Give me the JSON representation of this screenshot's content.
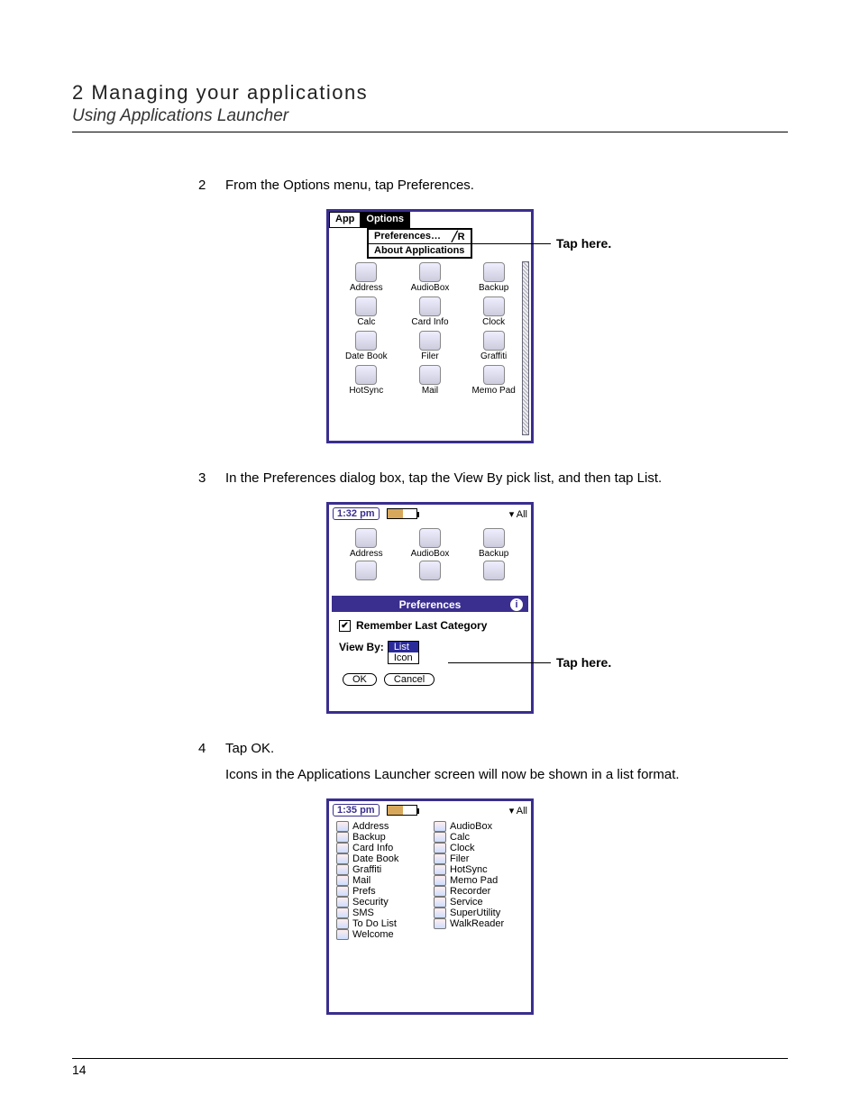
{
  "header": {
    "chapter": "2 Managing your applications",
    "section": "Using Applications Launcher"
  },
  "steps": {
    "s2": {
      "num": "2",
      "text": "From the Options menu, tap Preferences."
    },
    "s3": {
      "num": "3",
      "text": "In the Preferences dialog box, tap the View By pick list, and then tap List."
    },
    "s4": {
      "num": "4",
      "text": "Tap OK.",
      "sub": "Icons in the Applications Launcher screen will now be shown in a list format."
    }
  },
  "callouts": {
    "c1": "Tap here.",
    "c2": "Tap here."
  },
  "palm1": {
    "menu": {
      "app": "App",
      "options": "Options"
    },
    "dropdown": {
      "prefs": "Preferences…",
      "shortcut": "╱R",
      "about": "About Applications"
    },
    "apps": [
      "Address",
      "AudioBox",
      "Backup",
      "Calc",
      "Card Info",
      "Clock",
      "Date Book",
      "Filer",
      "Graffiti",
      "HotSync",
      "Mail",
      "Memo Pad"
    ]
  },
  "palm2": {
    "time": "1:32 pm",
    "picklist_all": "▾ All",
    "apps_top": [
      "Address",
      "AudioBox",
      "Backup"
    ],
    "dialog": {
      "title": "Preferences",
      "info": "i",
      "remember": "Remember Last Category",
      "viewby_label": "View By:",
      "opts": {
        "list": "List",
        "icon": "Icon"
      },
      "ok": "OK",
      "cancel": "Cancel"
    }
  },
  "palm3": {
    "time": "1:35 pm",
    "picklist_all": "▾ All",
    "list_left": [
      "Address",
      "Backup",
      "Card Info",
      "Date Book",
      "Graffiti",
      "Mail",
      "Prefs",
      "Security",
      "SMS",
      "To Do List",
      "Welcome"
    ],
    "list_right": [
      "AudioBox",
      "Calc",
      "Clock",
      "Filer",
      "HotSync",
      "Memo Pad",
      "Recorder",
      "Service",
      "SuperUtility",
      "WalkReader"
    ]
  },
  "page_number": "14"
}
